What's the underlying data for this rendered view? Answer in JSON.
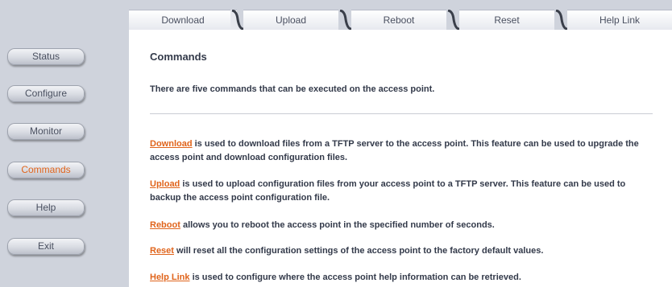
{
  "sidebar": {
    "items": [
      {
        "label": "Status"
      },
      {
        "label": "Configure"
      },
      {
        "label": "Monitor"
      },
      {
        "label": "Commands",
        "active": true
      },
      {
        "label": "Help"
      },
      {
        "label": "Exit"
      }
    ]
  },
  "tabs": [
    {
      "label": "Download"
    },
    {
      "label": "Upload"
    },
    {
      "label": "Reboot"
    },
    {
      "label": "Reset"
    },
    {
      "label": "Help Link"
    }
  ],
  "main": {
    "title": "Commands",
    "intro": "There are five commands that can be executed on the access point.",
    "descriptions": [
      {
        "link": "Download",
        "text": " is used to download files from a TFTP server to the access point. This feature can be used to upgrade the access point and download configuration files."
      },
      {
        "link": "Upload",
        "text": " is used to upload configuration files from your access point to a TFTP server. This feature can be used to backup the access point configuration file."
      },
      {
        "link": "Reboot",
        "text": " allows you to reboot the access point in the specified number of seconds."
      },
      {
        "link": "Reset",
        "text": " will reset all the configuration settings of the access point to the factory default values."
      },
      {
        "link": "Help Link",
        "text": " is used to configure where the access point help information can be retrieved."
      }
    ]
  },
  "colors": {
    "accent": "#e0641b",
    "sidebar_bg": "#cfd3dc",
    "text": "#333a4a"
  }
}
